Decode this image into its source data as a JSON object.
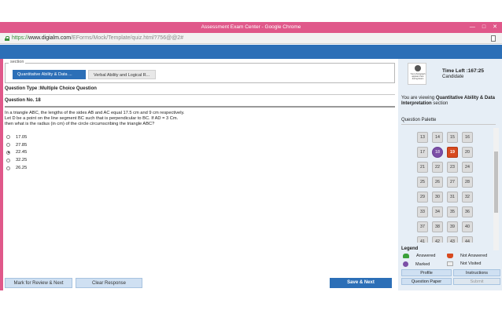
{
  "window": {
    "title": "Assessment Exam Center - Google Chrome"
  },
  "address": {
    "scheme": "https://",
    "host": "www.digialm.com",
    "path": "/EForms/Mock/Template/quiz.html?756@@2#"
  },
  "section": {
    "legend": "section",
    "tabs": [
      {
        "label": "Quantitative Ability & Data ..."
      },
      {
        "label": "Verbal Ability and Logical R..."
      }
    ]
  },
  "question": {
    "type_label": "Question Type :Multiple Choice Question",
    "number_label": "Question No. 18",
    "text_lines": [
      "In a triangle ABC, the lengths of the sides AB and AC equal 17.5 cm and 9 cm respectively.",
      "Let D be a point on the line segment BC such that is perpendicular to BC. If AD = 3 Cm.",
      "then what is the radius (in cm) of the circle circumscribing the triangle ABC?"
    ],
    "options": [
      "17.05",
      "27.85",
      "22.45",
      "32.25",
      "26.25"
    ],
    "selected_index": 2
  },
  "buttons": {
    "mark_review": "Mark for Review & Next",
    "clear": "Clear Response",
    "save_next": "Save & Next"
  },
  "candidate": {
    "photo_caption": "Your photograph appears here during Exam",
    "time_left": "Time Left :167:25",
    "name": "Candidate"
  },
  "viewing": {
    "prefix": "You are viewing ",
    "section": "Quantitative Ability & Data Interpretation",
    "suffix": " section"
  },
  "palette": {
    "title": "Question Palette",
    "cells": [
      {
        "n": "13",
        "state": "not-visited"
      },
      {
        "n": "14",
        "state": "not-visited"
      },
      {
        "n": "15",
        "state": "not-visited"
      },
      {
        "n": "16",
        "state": "not-visited"
      },
      {
        "n": "17",
        "state": "not-visited"
      },
      {
        "n": "18",
        "state": "marked"
      },
      {
        "n": "19",
        "state": "not-answered"
      },
      {
        "n": "20",
        "state": "not-visited"
      },
      {
        "n": "21",
        "state": "not-visited"
      },
      {
        "n": "22",
        "state": "not-visited"
      },
      {
        "n": "23",
        "state": "not-visited"
      },
      {
        "n": "24",
        "state": "not-visited"
      },
      {
        "n": "25",
        "state": "not-visited"
      },
      {
        "n": "26",
        "state": "not-visited"
      },
      {
        "n": "27",
        "state": "not-visited"
      },
      {
        "n": "28",
        "state": "not-visited"
      },
      {
        "n": "29",
        "state": "not-visited"
      },
      {
        "n": "30",
        "state": "not-visited"
      },
      {
        "n": "31",
        "state": "not-visited"
      },
      {
        "n": "32",
        "state": "not-visited"
      },
      {
        "n": "33",
        "state": "not-visited"
      },
      {
        "n": "34",
        "state": "not-visited"
      },
      {
        "n": "35",
        "state": "not-visited"
      },
      {
        "n": "36",
        "state": "not-visited"
      },
      {
        "n": "37",
        "state": "not-visited"
      },
      {
        "n": "38",
        "state": "not-visited"
      },
      {
        "n": "39",
        "state": "not-visited"
      },
      {
        "n": "40",
        "state": "not-visited"
      },
      {
        "n": "41",
        "state": "not-visited"
      },
      {
        "n": "42",
        "state": "not-visited"
      },
      {
        "n": "43",
        "state": "not-visited"
      },
      {
        "n": "44",
        "state": "not-visited"
      }
    ]
  },
  "legend": {
    "title": "Legend",
    "answered": "Answered",
    "not_answered": "Not Answered",
    "marked": "Marked",
    "not_visited": "Not Visited"
  },
  "panel_buttons": {
    "profile": "Profile",
    "instructions": "Instructions",
    "question_paper": "Question Paper",
    "submit": "Submit"
  },
  "colors": {
    "accent_blue": "#2c6fb7",
    "window_pink": "#e0588a",
    "answered_green": "#3aa03a",
    "not_answered_red": "#d74a1f",
    "marked_purple": "#7b4fa6"
  }
}
